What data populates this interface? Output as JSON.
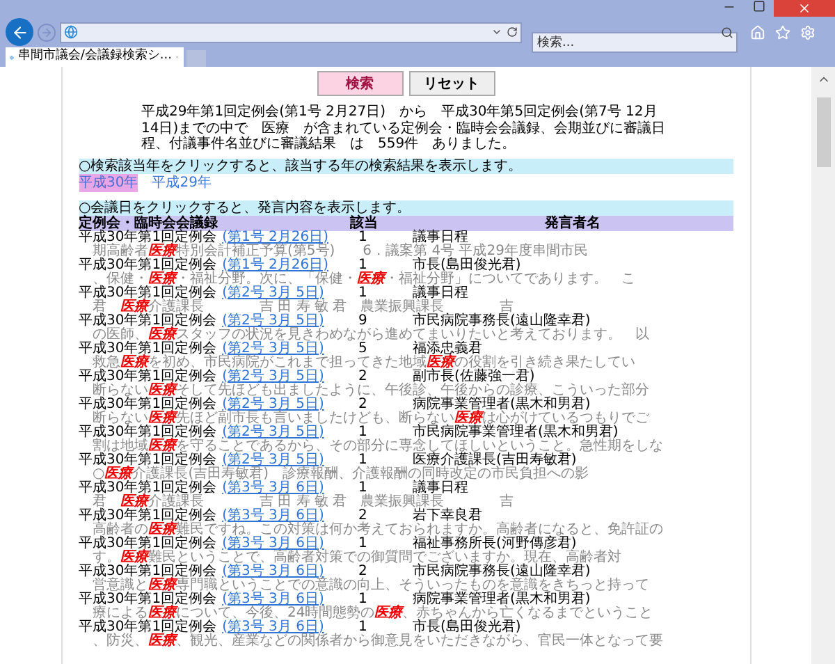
{
  "browser": {
    "search_placeholder": "検索...",
    "tab_title": "串間市議会/会議録検索シ..."
  },
  "buttons": [
    {
      "label": "検索",
      "kind": "primary"
    },
    {
      "label": "リセット",
      "kind": "secondary"
    }
  ],
  "summary": "平成29年第1回定例会(第1号 2月27日)　から　平成30年第5回定例会(第7号 12月14日)までの中で　医療　が含まれている定例会・臨時会会議録、会期並びに審議日程、付議事件名並びに審議結果　は　559件　ありました。",
  "year_note": "○検索該当年をクリックすると、該当する年の検索結果を表示します。",
  "years": [
    {
      "label": "平成30年",
      "selected": true
    },
    {
      "label": "平成29年",
      "selected": false
    }
  ],
  "date_note": "○会議日をクリックすると、発言内容を表示します。",
  "columns": [
    "定例会・臨時会会議録",
    "該当",
    "発言者名"
  ],
  "results": [
    {
      "session": "平成30年第1回定例会",
      "date": "(第1号 2月26日)",
      "count": "1",
      "speaker": "議事日程",
      "snippet": [
        {
          "text": "期高齢者",
          "hit": false
        },
        {
          "text": "医療",
          "hit": true
        },
        {
          "text": "特別会計補正予算(第5号)　　6．議案第 4号 平成29年度串間市民",
          "hit": false
        }
      ]
    },
    {
      "session": "平成30年第1回定例会",
      "date": "(第1号 2月26日)",
      "count": "1",
      "speaker": "市長(島田俊光君)",
      "snippet": [
        {
          "text": "、保健・",
          "hit": false
        },
        {
          "text": "医療",
          "hit": true
        },
        {
          "text": "・福祉分野。次に、「保健・",
          "hit": false
        },
        {
          "text": "医療",
          "hit": true
        },
        {
          "text": "・福祉分野」についてであります。　こ",
          "hit": false
        }
      ]
    },
    {
      "session": "平成30年第1回定例会",
      "date": "(第2号 3月 5日)",
      "count": "1",
      "speaker": "議事日程",
      "snippet": [
        {
          "text": "君　",
          "hit": false
        },
        {
          "text": "医療",
          "hit": true
        },
        {
          "text": "介護課長　　　　吉 田 寿 敏 君　農業振興課長　　　　吉",
          "hit": false
        }
      ]
    },
    {
      "session": "平成30年第1回定例会",
      "date": "(第2号 3月 5日)",
      "count": "9",
      "speaker": "市民病院事務長(遠山隆幸君)",
      "snippet": [
        {
          "text": "の医師、",
          "hit": false
        },
        {
          "text": "医療",
          "hit": true
        },
        {
          "text": "スタッフの状況を見きわめながら進めてまいりたいと考えております。　以",
          "hit": false
        }
      ]
    },
    {
      "session": "平成30年第1回定例会",
      "date": "(第2号 3月 5日)",
      "count": "5",
      "speaker": "福添忠義君",
      "snippet": [
        {
          "text": "救急",
          "hit": false
        },
        {
          "text": "医療",
          "hit": true
        },
        {
          "text": "を初め、市民病院がこれまで担ってきた地域",
          "hit": false
        },
        {
          "text": "医療",
          "hit": true
        },
        {
          "text": "の役割を引き続き果たしてい",
          "hit": false
        }
      ]
    },
    {
      "session": "平成30年第1回定例会",
      "date": "(第2号 3月 5日)",
      "count": "2",
      "speaker": "副市長(佐藤強一君)",
      "snippet": [
        {
          "text": "断らない",
          "hit": false
        },
        {
          "text": "医療",
          "hit": true
        },
        {
          "text": "そして先ほども出ましたように、午後診、午後からの診療、こういった部分",
          "hit": false
        }
      ]
    },
    {
      "session": "平成30年第1回定例会",
      "date": "(第2号 3月 5日)",
      "count": "2",
      "speaker": "病院事業管理者(黒木和男君)",
      "snippet": [
        {
          "text": "断らない",
          "hit": false
        },
        {
          "text": "医療",
          "hit": true
        },
        {
          "text": "先ほど副市長も言いましたけども、断らない",
          "hit": false
        },
        {
          "text": "医療",
          "hit": true
        },
        {
          "text": "は心がけているつもりでご",
          "hit": false
        }
      ]
    },
    {
      "session": "平成30年第1回定例会",
      "date": "(第2号 3月 5日)",
      "count": "1",
      "speaker": "市民病院事業管理者(黒木和男君)",
      "snippet": [
        {
          "text": "割は地域",
          "hit": false
        },
        {
          "text": "医療",
          "hit": true
        },
        {
          "text": "を守ることであるから、その部分に専念してほしいということ。急性期をしな",
          "hit": false
        }
      ]
    },
    {
      "session": "平成30年第1回定例会",
      "date": "(第2号 3月 5日)",
      "count": "1",
      "speaker": "医療介護課長(吉田寿敏君)",
      "snippet": [
        {
          "text": "○",
          "hit": false
        },
        {
          "text": "医療",
          "hit": true
        },
        {
          "text": "介護課長(吉田寿敏君)　診療報酬、介護報酬の同時改定の市民負担への影",
          "hit": false
        }
      ]
    },
    {
      "session": "平成30年第1回定例会",
      "date": "(第3号 3月 6日)",
      "count": "1",
      "speaker": "議事日程",
      "snippet": [
        {
          "text": "君　",
          "hit": false
        },
        {
          "text": "医療",
          "hit": true
        },
        {
          "text": "介護課長　　　　吉 田 寿 敏 君　農業振興課長　　　　吉",
          "hit": false
        }
      ]
    },
    {
      "session": "平成30年第1回定例会",
      "date": "(第3号 3月 6日)",
      "count": "2",
      "speaker": "岩下幸良君",
      "snippet": [
        {
          "text": "高齢者の",
          "hit": false
        },
        {
          "text": "医療",
          "hit": true
        },
        {
          "text": "難民ですね。この対策は何か考えておられますか。高齢者になると、免許証の",
          "hit": false
        }
      ]
    },
    {
      "session": "平成30年第1回定例会",
      "date": "(第3号 3月 6日)",
      "count": "1",
      "speaker": "福祉事務所長(河野傳彦君)",
      "snippet": [
        {
          "text": "す。",
          "hit": false
        },
        {
          "text": "医療",
          "hit": true
        },
        {
          "text": "難民ということで、高齢者対策での御質問でございますか。現在、高齢者対",
          "hit": false
        }
      ]
    },
    {
      "session": "平成30年第1回定例会",
      "date": "(第3号 3月 6日)",
      "count": "2",
      "speaker": "市民病院事務長(遠山隆幸君)",
      "snippet": [
        {
          "text": "営意識と",
          "hit": false
        },
        {
          "text": "医療",
          "hit": true
        },
        {
          "text": "専門職ということでの意識の向上、そういったものを意識をきちっと持って",
          "hit": false
        }
      ]
    },
    {
      "session": "平成30年第1回定例会",
      "date": "(第3号 3月 6日)",
      "count": "1",
      "speaker": "病院事業管理者(黒木和男君)",
      "snippet": [
        {
          "text": "療による",
          "hit": false
        },
        {
          "text": "医療",
          "hit": true
        },
        {
          "text": "について、今後、24時間態勢の",
          "hit": false
        },
        {
          "text": "医療",
          "hit": true
        },
        {
          "text": "、赤ちゃんから亡くなるまでということ",
          "hit": false
        }
      ]
    },
    {
      "session": "平成30年第1回定例会",
      "date": "(第3号 3月 6日)",
      "count": "1",
      "speaker": "市長(島田俊光君)",
      "snippet": [
        {
          "text": "、防災、",
          "hit": false
        },
        {
          "text": "医療",
          "hit": true
        },
        {
          "text": "、観光、産業などの関係者から御意見をいただきながら、官民一体となって要",
          "hit": false
        }
      ]
    }
  ]
}
